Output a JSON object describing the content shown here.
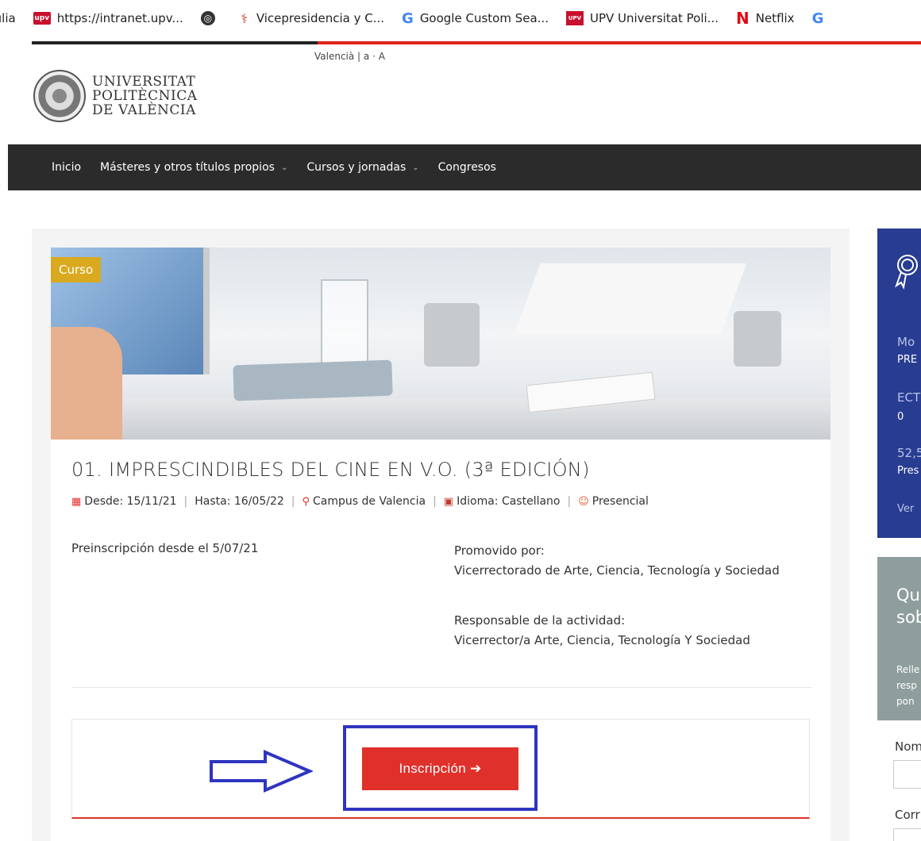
{
  "bookmarks": [
    {
      "label": "ılia",
      "icon": "truncated"
    },
    {
      "label": "https://intranet.upv...",
      "icon": "upv-icon",
      "icon_text": "upv"
    },
    {
      "label": "",
      "icon": "globe-icon"
    },
    {
      "label": "Vicepresidencia y C...",
      "icon": "vicepresidencia-icon"
    },
    {
      "label": "Google Custom Sea...",
      "icon": "google-icon"
    },
    {
      "label": "UPV Universitat Poli...",
      "icon": "upv-red-icon",
      "icon_text": "UPV"
    },
    {
      "label": "Netflix",
      "icon": "netflix-icon"
    },
    {
      "label": "G",
      "icon": "google-icon"
    }
  ],
  "header": {
    "lang_line": "Valencià  |  a · A",
    "logo_lines": [
      "UNIVERSITAT",
      "POLITÈCNICA",
      "DE  VALÈNCIA"
    ]
  },
  "nav": {
    "items": [
      {
        "label": "Inicio",
        "dropdown": false
      },
      {
        "label": "Másteres y otros títulos propios",
        "dropdown": true
      },
      {
        "label": "Cursos y jornadas",
        "dropdown": true
      },
      {
        "label": "Congresos",
        "dropdown": false
      }
    ],
    "caret": "⌄"
  },
  "course": {
    "badge": "Curso",
    "title": "01. IMPRESCINDIBLES DEL CINE EN V.O. (3ª EDICIÓN)",
    "desde": "Desde: 15/11/21",
    "hasta": "Hasta: 16/05/22",
    "campus": "Campus de Valencia",
    "idioma": "Idioma: Castellano",
    "modalidad": "Presencial",
    "preinscripcion": "Preinscripción desde el 5/07/21",
    "promovido_label": "Promovido por:",
    "promovido_value": "Vicerrectorado de Arte, Ciencia, Tecnología y Sociedad",
    "responsable_label": "Responsable de la actividad:",
    "responsable_value": "Vicerrector/a Arte, Ciencia, Tecnología Y Sociedad",
    "inscripcion_button": "Inscripción ➔"
  },
  "sidebar": {
    "modalidad_label": "Mo",
    "modalidad_value": "PRE",
    "ects_label": "ECT",
    "ects_value": "0",
    "price_label": "52,5",
    "price_value": "Pres",
    "more_link": "Ver",
    "question_line1": "Qu",
    "question_line2": "sob",
    "note_line1": "Relle",
    "note_line2": "resp",
    "note_line3": "pon",
    "name_label": "Nom",
    "email_label": "Corr"
  },
  "colors": {
    "accent_red": "#e0302a",
    "nav_bg": "#2b2b2b",
    "badge": "#d9a920",
    "sidebar_blue": "#283c91",
    "sidebar_gray": "#8e9e9c",
    "annotation_blue": "#2e35c0"
  }
}
